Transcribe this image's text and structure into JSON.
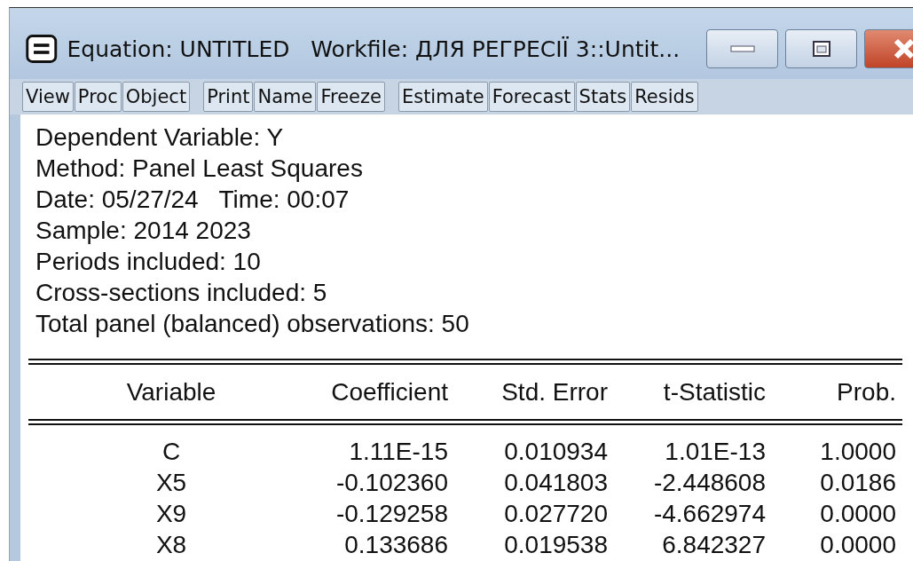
{
  "window": {
    "title": "Equation: UNTITLED   Workfile: ДЛЯ РЕГРЕСІЇ 3::Untit..."
  },
  "toolbar": {
    "groups": [
      [
        "View",
        "Proc",
        "Object"
      ],
      [
        "Print",
        "Name",
        "Freeze"
      ],
      [
        "Estimate",
        "Forecast",
        "Stats",
        "Resids"
      ]
    ]
  },
  "header_lines": [
    "Dependent Variable: Y",
    "Method: Panel Least Squares",
    "Date: 05/27/24   Time: 00:07",
    "Sample: 2014 2023",
    "Periods included: 10",
    "Cross-sections included: 5",
    "Total panel (balanced) observations: 50"
  ],
  "table": {
    "columns": [
      "Variable",
      "Coefficient",
      "Std. Error",
      "t-Statistic",
      "Prob."
    ],
    "rows": [
      [
        "C",
        "1.11E-15",
        "0.010934",
        "1.01E-13",
        "1.0000"
      ],
      [
        "X5",
        "-0.102360",
        "0.041803",
        "-2.448608",
        "0.0186"
      ],
      [
        "X9",
        "-0.129258",
        "0.027720",
        "-4.662974",
        "0.0000"
      ],
      [
        "X8",
        "0.133686",
        "0.019538",
        "6.842327",
        "0.0000"
      ]
    ]
  }
}
